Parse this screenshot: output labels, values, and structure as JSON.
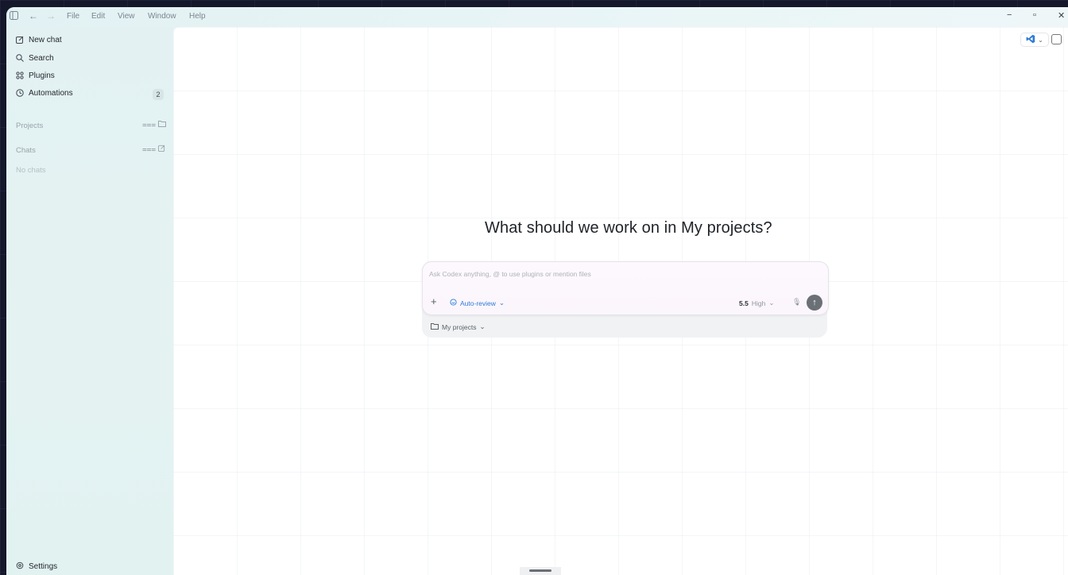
{
  "menu": {
    "items": [
      "File",
      "Edit",
      "View",
      "Window",
      "Help"
    ]
  },
  "sidebar": {
    "items": [
      {
        "label": "New chat",
        "icon": "edit-icon"
      },
      {
        "label": "Search",
        "icon": "search-icon"
      },
      {
        "label": "Plugins",
        "icon": "grid-icon"
      },
      {
        "label": "Automations",
        "icon": "clock-icon",
        "badge": "2"
      }
    ],
    "projects_label": "Projects",
    "chats_label": "Chats",
    "empty_chats": "No chats",
    "settings_label": "Settings"
  },
  "main": {
    "headline": "What should we work on in My projects?",
    "composer": {
      "placeholder": "Ask Codex anything, @ to use plugins or mention files",
      "mode": "Auto-review",
      "model": "5.5",
      "effort": "High",
      "project": "My projects"
    }
  },
  "colors": {
    "accent": "#2f7bd8",
    "vscode": "#2f7bd8"
  }
}
